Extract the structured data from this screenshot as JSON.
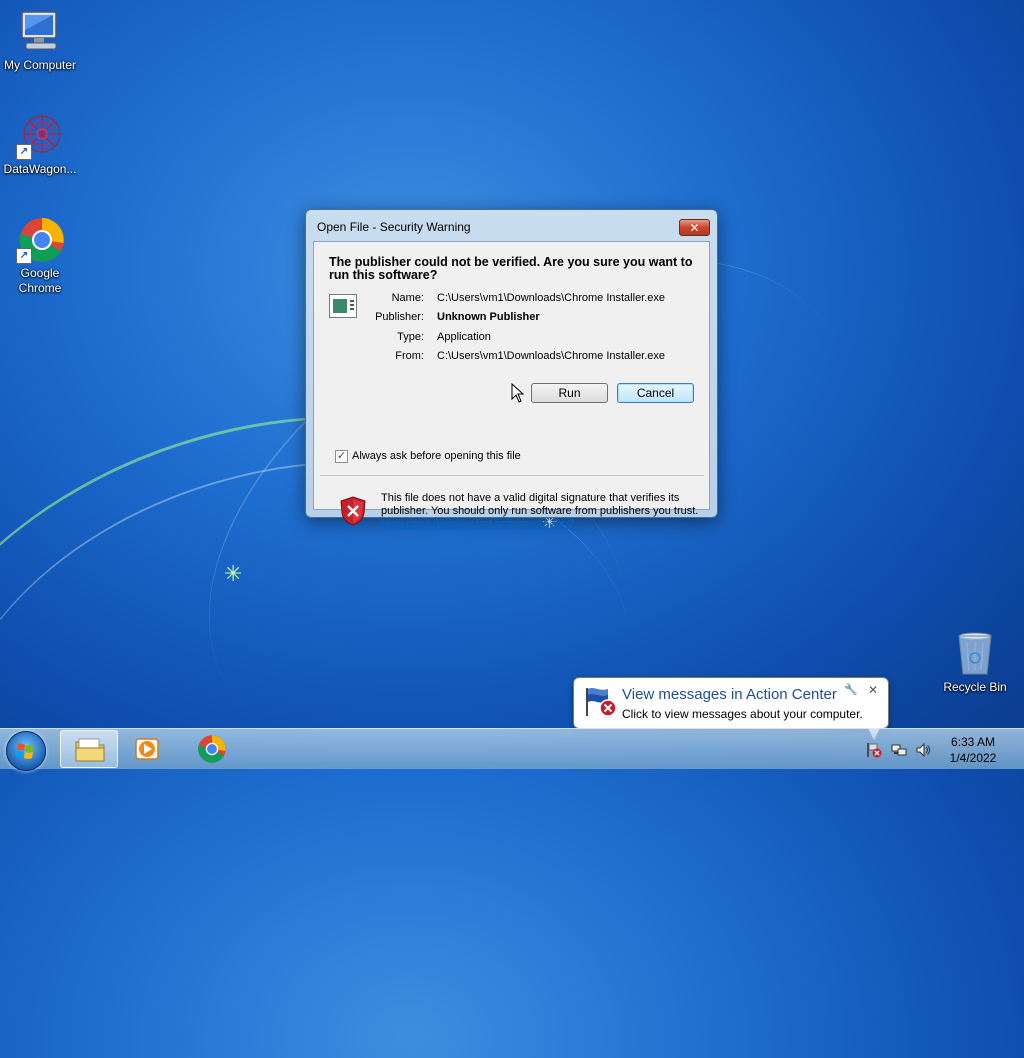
{
  "desktop": {
    "icons": [
      {
        "label": "My Computer",
        "icon": "computer-icon"
      },
      {
        "label": "DataWagon...",
        "icon": "datawagon-icon"
      },
      {
        "label": "Google Chrome",
        "icon": "chrome-icon"
      },
      {
        "label": "Recycle Bin",
        "icon": "recycle-bin-icon"
      }
    ]
  },
  "dialog": {
    "title": "Open File - Security Warning",
    "close_label": "✕",
    "headline": "The publisher could not be verified.  Are you sure you want to run this software?",
    "fields": [
      {
        "label": "Name:",
        "value": "C:\\Users\\vm1\\Downloads\\Chrome Installer.exe"
      },
      {
        "label": "Publisher:",
        "value": "Unknown Publisher"
      },
      {
        "label": "Type:",
        "value": "Application"
      },
      {
        "label": "From:",
        "value": "C:\\Users\\vm1\\Downloads\\Chrome Installer.exe"
      }
    ],
    "run_label": "Run",
    "cancel_label": "Cancel",
    "checkbox_label": "Always ask before opening this file",
    "checkbox_checked": true,
    "checkbox_mark": "✓",
    "warning_text": "This file does not have a valid digital signature that verifies its publisher.  You should only run software from publishers you trust.",
    "help_link": "How can I decide what software to run?"
  },
  "balloon": {
    "title": "View messages in Action Center",
    "text": "Click to view messages about your computer.",
    "close_label": "✕"
  },
  "taskbar": {
    "time": "6:33 AM",
    "date": "1/4/2022"
  }
}
